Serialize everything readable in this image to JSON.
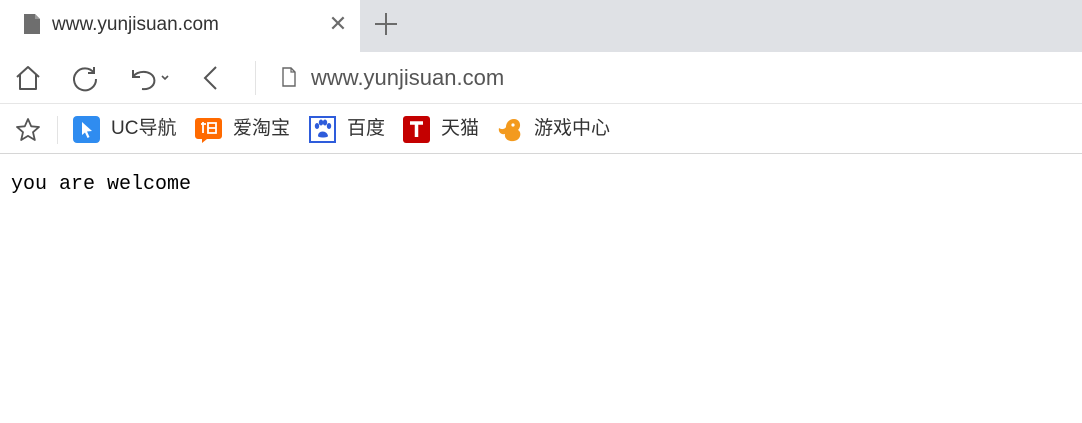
{
  "tab": {
    "title": "www.yunjisuan.com",
    "close_glyph": "✕"
  },
  "address_bar": {
    "url": "www.yunjisuan.com"
  },
  "bookmarks": [
    {
      "label": "UC导航",
      "icon": "uc-nav-icon",
      "color": "#2f8cf0"
    },
    {
      "label": "爱淘宝",
      "icon": "taobao-icon",
      "color": "#ff6a00"
    },
    {
      "label": "百度",
      "icon": "baidu-paw-icon",
      "color": "#2e5cdb"
    },
    {
      "label": "天猫",
      "icon": "tmall-icon",
      "color": "#c40000"
    },
    {
      "label": "游戏中心",
      "icon": "game-squirrel-icon",
      "color": "#f39a1e"
    }
  ],
  "page": {
    "body_text": "you are welcome"
  }
}
